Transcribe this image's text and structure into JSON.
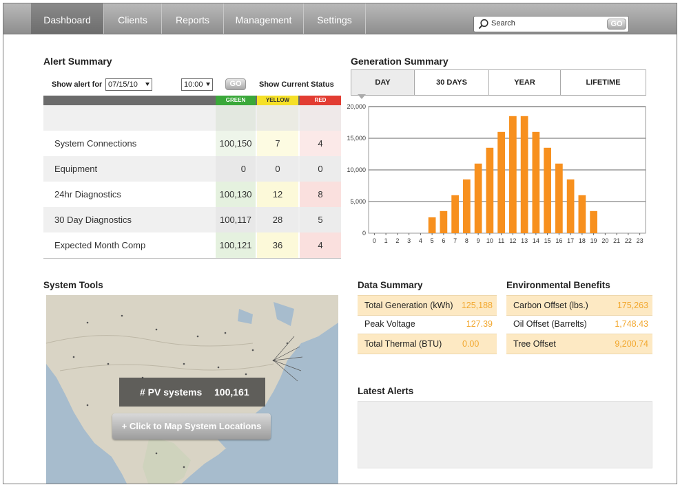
{
  "nav": {
    "tabs": [
      {
        "label": "Dashboard",
        "active": true
      },
      {
        "label": "Clients"
      },
      {
        "label": "Reports"
      },
      {
        "label": "Management"
      },
      {
        "label": "Settings"
      }
    ],
    "search_placeholder": "Search",
    "search_go": "GO"
  },
  "alert_summary": {
    "title": "Alert Summary",
    "show_alert_label": "Show alert for",
    "date_value": "07/15/10",
    "time_value": "10:00",
    "go_label": "GO",
    "status_label": "Show Current Status",
    "columns": [
      "GREEN",
      "YELLOW",
      "RED"
    ],
    "column_colors": {
      "green": "#3aa83a",
      "yellow": "#f5e027",
      "red": "#e23c32"
    },
    "rows": [
      {
        "label": "System Connections",
        "green": "100,150",
        "yellow": "7",
        "red": "4"
      },
      {
        "label": "Equipment",
        "green": "0",
        "yellow": "0",
        "red": "0"
      },
      {
        "label": "24hr Diagnostics",
        "green": "100,130",
        "yellow": "12",
        "red": "8"
      },
      {
        "label": "30 Day Diagnostics",
        "green": "100,117",
        "yellow": "28",
        "red": "5"
      },
      {
        "label": "Expected Month Comp",
        "green": "100,121",
        "yellow": "36",
        "red": "4"
      }
    ]
  },
  "generation_summary": {
    "title": "Generation Summary",
    "tabs": [
      {
        "label": "DAY",
        "active": true
      },
      {
        "label": "30 DAYS"
      },
      {
        "label": "YEAR"
      },
      {
        "label": "LIFETIME"
      }
    ]
  },
  "chart_data": {
    "type": "bar",
    "title": "",
    "xlabel": "",
    "ylabel": "",
    "ylim": [
      0,
      20000
    ],
    "y_ticks": [
      "0",
      "5,000",
      "10,000",
      "15,000",
      "20,000"
    ],
    "y_tick_values": [
      0,
      5000,
      10000,
      15000,
      20000
    ],
    "categories": [
      "0",
      "1",
      "2",
      "3",
      "4",
      "5",
      "6",
      "7",
      "8",
      "9",
      "10",
      "11",
      "12",
      "13",
      "14",
      "15",
      "16",
      "17",
      "18",
      "19",
      "20",
      "21",
      "22",
      "23"
    ],
    "values": [
      0,
      0,
      0,
      0,
      0,
      2500,
      3500,
      6000,
      8500,
      11000,
      13500,
      16000,
      18500,
      18500,
      16000,
      13500,
      11000,
      8500,
      6000,
      3500,
      0,
      0,
      0,
      0
    ],
    "bar_color": "#f7901e",
    "grid": true
  },
  "data_summary": {
    "title": "Data Summary",
    "items": [
      {
        "label": "Total Generation (kWh)",
        "value": "125,188"
      },
      {
        "label": "Peak Voltage",
        "value": "127.39"
      },
      {
        "label": "Total Thermal (BTU)",
        "value": "0.00"
      }
    ]
  },
  "environmental": {
    "title": "Environmental Benefits",
    "items": [
      {
        "label": "Carbon Offset (lbs.)",
        "value": "175,263"
      },
      {
        "label": "Oil Offset (Barrelts)",
        "value": "1,748.43"
      },
      {
        "label": "Tree Offset",
        "value": "9,200.74"
      }
    ]
  },
  "system_tools": {
    "title": "System Tools",
    "pv_label": "# PV systems",
    "pv_value": "100,161",
    "map_button": "+ Click to Map System Locations"
  },
  "latest_alerts": {
    "title": "Latest Alerts"
  }
}
